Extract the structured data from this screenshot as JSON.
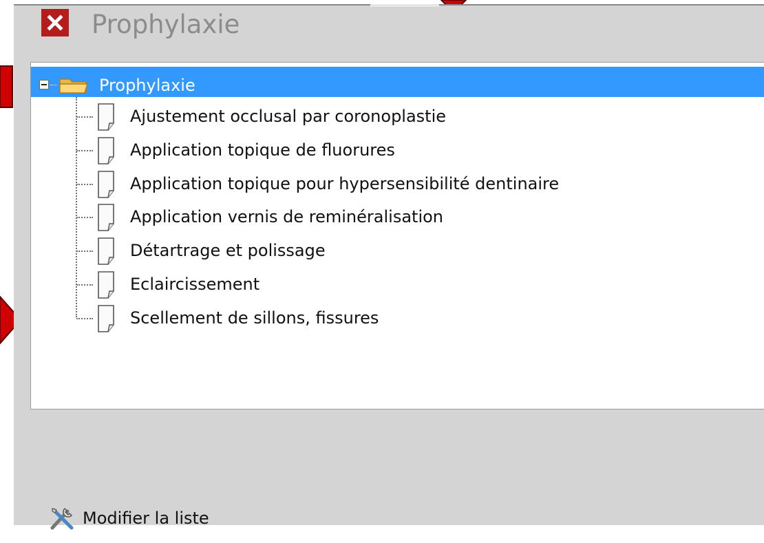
{
  "window": {
    "title": "Prophylaxie",
    "close_icon": "close-x-icon"
  },
  "tree": {
    "root": {
      "label": "Prophylaxie",
      "expanded": true,
      "selected": true,
      "expander_icon": "collapse-minus-icon",
      "icon": "folder-icon"
    },
    "items": [
      {
        "label": "Ajustement occlusal par coronoplastie",
        "icon": "document-icon"
      },
      {
        "label": "Application topique de fluorures",
        "icon": "document-icon"
      },
      {
        "label": "Application topique pour hypersensibilité dentinaire",
        "icon": "document-icon"
      },
      {
        "label": "Application vernis de reminéralisation",
        "icon": "document-icon"
      },
      {
        "label": "Détartrage et polissage",
        "icon": "document-icon"
      },
      {
        "label": "Eclaircissement",
        "icon": "document-icon"
      },
      {
        "label": "Scellement de sillons, fissures",
        "icon": "document-icon"
      }
    ]
  },
  "footer": {
    "modify_label": "Modifier la liste",
    "modify_icon": "tools-icon"
  },
  "colors": {
    "panel_background": "#d4d4d4",
    "selection_highlight": "#3399ff",
    "close_button": "#b51c1c",
    "annotation_arrow": "#d10000"
  }
}
